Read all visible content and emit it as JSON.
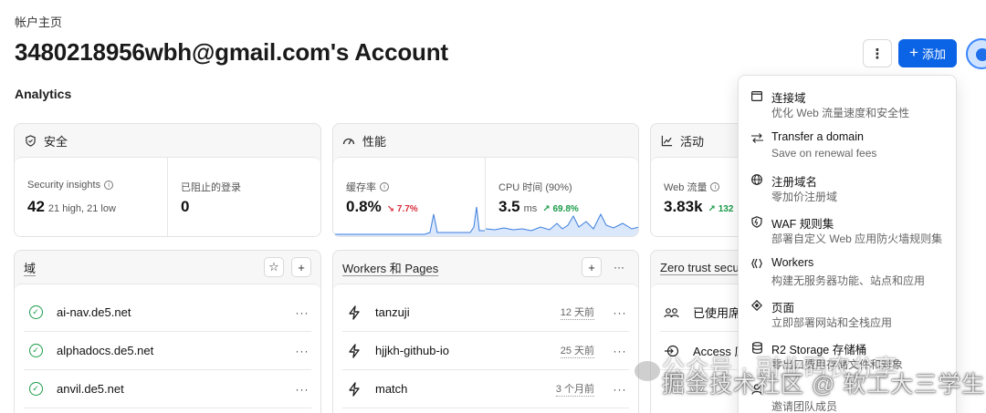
{
  "breadcrumb": "帐户主页",
  "page_title": "3480218956wbh@gmail.com's Account",
  "section_title": "Analytics",
  "actions": {
    "more": "⋮",
    "add_label": "添加",
    "add_icon": "+"
  },
  "cards": {
    "security": {
      "title": "安全",
      "metrics": [
        {
          "label": "Security insights",
          "value": "42",
          "sub": "21 high, 21 low"
        },
        {
          "label": "已阻止的登录",
          "value": "0"
        }
      ]
    },
    "performance": {
      "title": "性能",
      "metrics": [
        {
          "label": "缓存率",
          "value": "0.8%",
          "delta": "↘ 7.7%"
        },
        {
          "label": "CPU 时间 (90%)",
          "value": "3.5",
          "unit": "ms",
          "delta": "↗ 69.8%"
        }
      ]
    },
    "activity": {
      "title": "活动",
      "metrics": [
        {
          "label": "Web 流量",
          "value": "3.83k",
          "delta": "↗ 132"
        }
      ]
    },
    "domains": {
      "title": "域",
      "rows": [
        {
          "label": "ai-nav.de5.net"
        },
        {
          "label": "alphadocs.de5.net"
        },
        {
          "label": "anvil.de5.net"
        }
      ]
    },
    "workers": {
      "title": "Workers 和 Pages",
      "rows": [
        {
          "label": "tanzuji",
          "meta": "12 天前"
        },
        {
          "label": "hjjkh-github-io",
          "meta": "25 天前"
        },
        {
          "label": "match",
          "meta": "3 个月前"
        }
      ]
    },
    "zero_trust": {
      "title": "Zero trust secur",
      "rows": [
        {
          "label": "已使用席位"
        },
        {
          "label": "Access 应"
        }
      ]
    }
  },
  "dropdown": {
    "items": [
      {
        "title": "连接域",
        "desc": "优化 Web 流量速度和安全性",
        "icon": "window-icon"
      },
      {
        "title": "Transfer a domain",
        "desc": "Save on renewal fees",
        "icon": "transfer-icon"
      },
      {
        "title": "注册域名",
        "desc": "零加价注册域",
        "icon": "globe-icon"
      },
      {
        "title": "WAF 规则集",
        "desc": "部署自定义 Web 应用防火墙规则集",
        "icon": "shield-icon"
      },
      {
        "title": "Workers",
        "desc": "构建无服务器功能、站点和应用",
        "icon": "workers-icon"
      },
      {
        "title": "页面",
        "desc": "立即部署网站和全栈应用",
        "icon": "pages-icon"
      },
      {
        "title": "R2 Storage 存储桶",
        "desc": "零出口费用存储文件和对象",
        "icon": "database-icon"
      },
      {
        "title": "",
        "desc": "邀请团队成员",
        "icon": "user-icon"
      }
    ]
  },
  "watermark": {
    "line1": "公众号 · 副业码农分享",
    "line2": "掘金技术社区 @ 软工大三学生"
  }
}
